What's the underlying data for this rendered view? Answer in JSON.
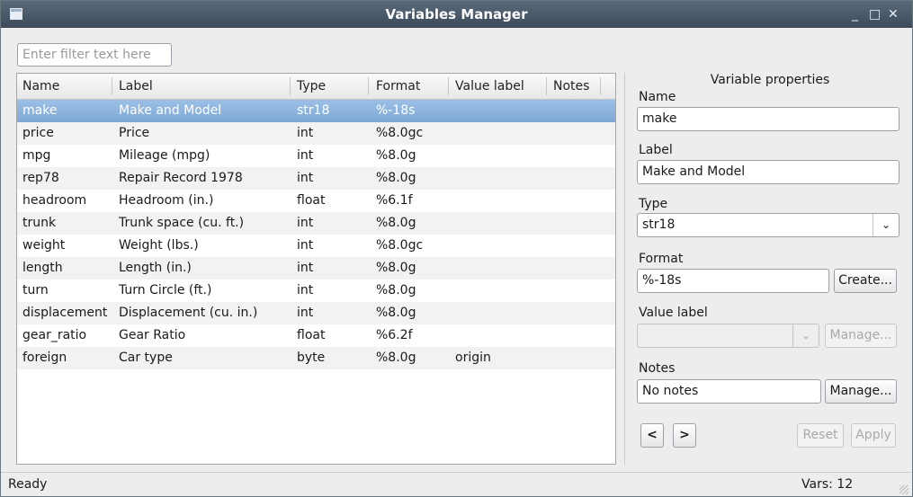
{
  "window": {
    "title": "Variables Manager",
    "minimize": "_",
    "maximize": "□",
    "close": "✕"
  },
  "filter": {
    "placeholder": "Enter filter text here",
    "value": ""
  },
  "table": {
    "columns": [
      "Name",
      "Label",
      "Type",
      "Format",
      "Value label",
      "Notes"
    ],
    "rows": [
      {
        "name": "make",
        "label": "Make and Model",
        "type": "str18",
        "format": "%-18s",
        "value_label": "",
        "notes": ""
      },
      {
        "name": "price",
        "label": "Price",
        "type": "int",
        "format": "%8.0gc",
        "value_label": "",
        "notes": ""
      },
      {
        "name": "mpg",
        "label": "Mileage (mpg)",
        "type": "int",
        "format": "%8.0g",
        "value_label": "",
        "notes": ""
      },
      {
        "name": "rep78",
        "label": "Repair Record 1978",
        "type": "int",
        "format": "%8.0g",
        "value_label": "",
        "notes": ""
      },
      {
        "name": "headroom",
        "label": "Headroom (in.)",
        "type": "float",
        "format": "%6.1f",
        "value_label": "",
        "notes": ""
      },
      {
        "name": "trunk",
        "label": "Trunk space (cu. ft.)",
        "type": "int",
        "format": "%8.0g",
        "value_label": "",
        "notes": ""
      },
      {
        "name": "weight",
        "label": "Weight (lbs.)",
        "type": "int",
        "format": "%8.0gc",
        "value_label": "",
        "notes": ""
      },
      {
        "name": "length",
        "label": "Length (in.)",
        "type": "int",
        "format": "%8.0g",
        "value_label": "",
        "notes": ""
      },
      {
        "name": "turn",
        "label": "Turn Circle (ft.)",
        "type": "int",
        "format": "%8.0g",
        "value_label": "",
        "notes": ""
      },
      {
        "name": "displacement",
        "label": "Displacement (cu. in.)",
        "type": "int",
        "format": "%8.0g",
        "value_label": "",
        "notes": ""
      },
      {
        "name": "gear_ratio",
        "label": "Gear Ratio",
        "type": "float",
        "format": "%6.2f",
        "value_label": "",
        "notes": ""
      },
      {
        "name": "foreign",
        "label": "Car type",
        "type": "byte",
        "format": "%8.0g",
        "value_label": "origin",
        "notes": ""
      }
    ],
    "selected_index": 0
  },
  "properties": {
    "title": "Variable properties",
    "name_label": "Name",
    "name_value": "make",
    "label_label": "Label",
    "label_value": "Make and Model",
    "type_label": "Type",
    "type_value": "str18",
    "format_label": "Format",
    "format_value": "%-18s",
    "create_button": "Create...",
    "value_label_label": "Value label",
    "value_label_value": "",
    "value_label_manage": "Manage...",
    "notes_label": "Notes",
    "notes_value": "No notes",
    "notes_manage": "Manage...",
    "prev_button": "<",
    "next_button": ">",
    "reset_button": "Reset",
    "apply_button": "Apply"
  },
  "status": {
    "text": "Ready",
    "vars": "Vars: 12"
  },
  "colors": {
    "titlebar": "#46566a",
    "selection": "#8db4de"
  }
}
